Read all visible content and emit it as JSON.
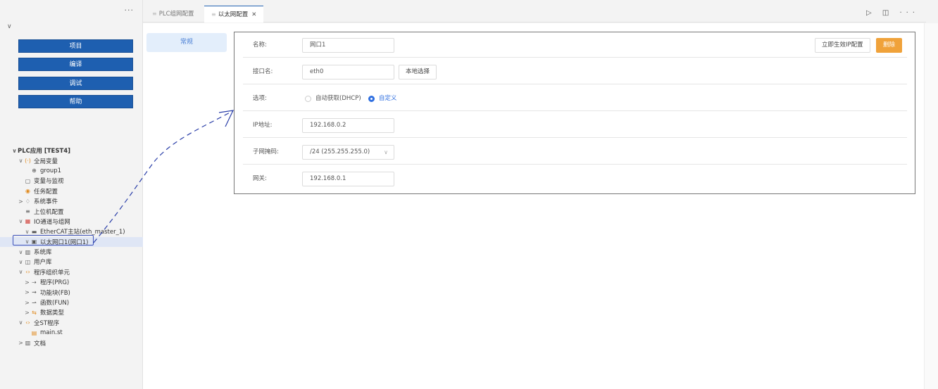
{
  "sidebar": {
    "more_icon": "ellipsis-icon",
    "buttons": [
      "项目",
      "编译",
      "调试",
      "帮助"
    ],
    "tree": [
      {
        "twist": "∨",
        "icon": "",
        "label": "PLC应用 [TEST4]",
        "indent": 0,
        "bold": true
      },
      {
        "twist": "∨",
        "icon": "(·)",
        "label": "全局变量",
        "indent": 1
      },
      {
        "twist": "",
        "icon": "⊕",
        "label": "group1",
        "indent": 2
      },
      {
        "twist": "",
        "icon": "▢",
        "label": "变量与监视",
        "indent": 1
      },
      {
        "twist": "",
        "icon": "◉",
        "label": "任务配置",
        "indent": 1
      },
      {
        "twist": ">",
        "icon": "♢",
        "label": "系统事件",
        "indent": 1
      },
      {
        "twist": "",
        "icon": "≡",
        "label": "上位机配置",
        "indent": 1
      },
      {
        "twist": "∨",
        "icon": "▦",
        "label": "IO通道与组网",
        "indent": 1
      },
      {
        "twist": "∨",
        "icon": "▬",
        "label": "EtherCAT主站(eth_master_1)",
        "indent": 2
      },
      {
        "twist": "∨",
        "icon": "▣",
        "label": "以太网口1(网口1)",
        "indent": 2,
        "selected": true
      },
      {
        "twist": "∨",
        "icon": "▥",
        "label": "系统库",
        "indent": 1
      },
      {
        "twist": "∨",
        "icon": "◫",
        "label": "用户库",
        "indent": 1
      },
      {
        "twist": "∨",
        "icon": "‹›",
        "label": "程序组织单元",
        "indent": 1
      },
      {
        "twist": ">",
        "icon": "⇢",
        "label": "程序(PRG)",
        "indent": 2
      },
      {
        "twist": ">",
        "icon": "⇝",
        "label": "功能块(FB)",
        "indent": 2
      },
      {
        "twist": ">",
        "icon": "⇀",
        "label": "函数(FUN)",
        "indent": 2
      },
      {
        "twist": ">",
        "icon": "⇆",
        "label": "数据类型",
        "indent": 2
      },
      {
        "twist": "∨",
        "icon": "‹›",
        "label": "全ST程序",
        "indent": 1
      },
      {
        "twist": "",
        "icon": "▤",
        "label": "main.st",
        "indent": 2
      },
      {
        "twist": ">",
        "icon": "▥",
        "label": "文档",
        "indent": 1
      }
    ]
  },
  "tabs": [
    {
      "label": "PLC组网配置",
      "active": false
    },
    {
      "label": "以太网配置",
      "active": true
    }
  ],
  "tab_actions": "▷ ◫ ···",
  "category": "常规",
  "form": {
    "name_label": "名称:",
    "name_value": "网口1",
    "apply_button": "立即生效IP配置",
    "delete_button": "删除",
    "iface_label": "接口名:",
    "iface_value": "eth0",
    "local_select_button": "本地选择",
    "option_label": "选项:",
    "option_dhcp": "自动获取(DHCP)",
    "option_custom": "自定义",
    "ip_label": "IP地址:",
    "ip_value": "192.168.0.2",
    "mask_label": "子网掩码:",
    "mask_value": "/24 (255.255.255.0)",
    "gw_label": "网关:",
    "gw_value": "192.168.0.1"
  }
}
